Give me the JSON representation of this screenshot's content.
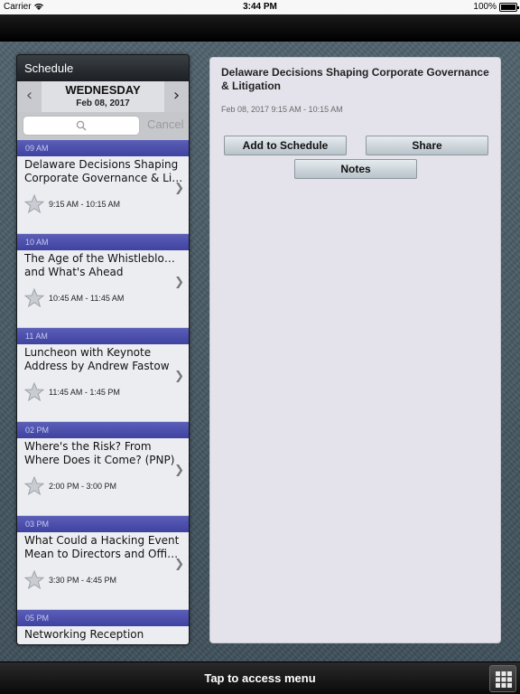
{
  "status_bar": {
    "carrier": "Carrier",
    "wifi_icon": "wifi-icon",
    "time": "3:44 PM",
    "battery": "100%",
    "battery_icon": "battery-icon"
  },
  "schedule": {
    "title": "Schedule",
    "day": {
      "name": "WEDNESDAY",
      "date": "Feb 08, 2017",
      "prev_icon": "chevron-left-icon",
      "next_icon": "chevron-right-icon"
    },
    "search": {
      "icon": "search-icon",
      "placeholder": "",
      "cancel_label": "Cancel"
    },
    "groups": [
      {
        "time_header": "09 AM",
        "sessions": [
          {
            "title_lines": [
              "Delaware Decisions Shaping",
              "Corporate Governance & Liti..."
            ],
            "time": "9:15 AM - 10:15 AM",
            "starred": false
          }
        ]
      },
      {
        "time_header": "10 AM",
        "sessions": [
          {
            "title_lines": [
              "The Age of the Whistleblower",
              "and What's Ahead"
            ],
            "time": "10:45 AM - 11:45 AM",
            "starred": false
          }
        ]
      },
      {
        "time_header": "11 AM",
        "sessions": [
          {
            "title_lines": [
              "Luncheon with Keynote",
              "Address by Andrew Fastow"
            ],
            "time": "11:45 AM - 1:45 PM",
            "starred": false
          }
        ]
      },
      {
        "time_header": "02 PM",
        "sessions": [
          {
            "title_lines": [
              "Where's the Risk? From",
              "Where Does it Come? (PNP)"
            ],
            "time": "2:00 PM - 3:00 PM",
            "starred": false
          }
        ]
      },
      {
        "time_header": "03 PM",
        "sessions": [
          {
            "title_lines": [
              "What Could a Hacking Event",
              "Mean to Directors and Office..."
            ],
            "time": "3:30 PM - 4:45 PM",
            "starred": false
          }
        ]
      },
      {
        "time_header": "05 PM",
        "sessions": [
          {
            "title_lines": [
              "Networking Reception",
              ""
            ],
            "time": "",
            "starred": false
          }
        ]
      }
    ]
  },
  "detail": {
    "title": "Delaware Decisions Shaping Corporate Governance & Litigation",
    "datetime": "Feb 08, 2017 9:15 AM - 10:15 AM",
    "buttons": {
      "add": "Add to Schedule",
      "share": "Share",
      "notes": "Notes"
    }
  },
  "bottom_bar": {
    "label": "Tap to access menu",
    "menu_icon": "grid-menu-icon"
  },
  "colors": {
    "time_header": "#4649a8",
    "session_bg": "#ecedf1",
    "detail_bg": "#e4e3ec",
    "bar_black": "#000000",
    "backdrop": "#4b5c66"
  }
}
